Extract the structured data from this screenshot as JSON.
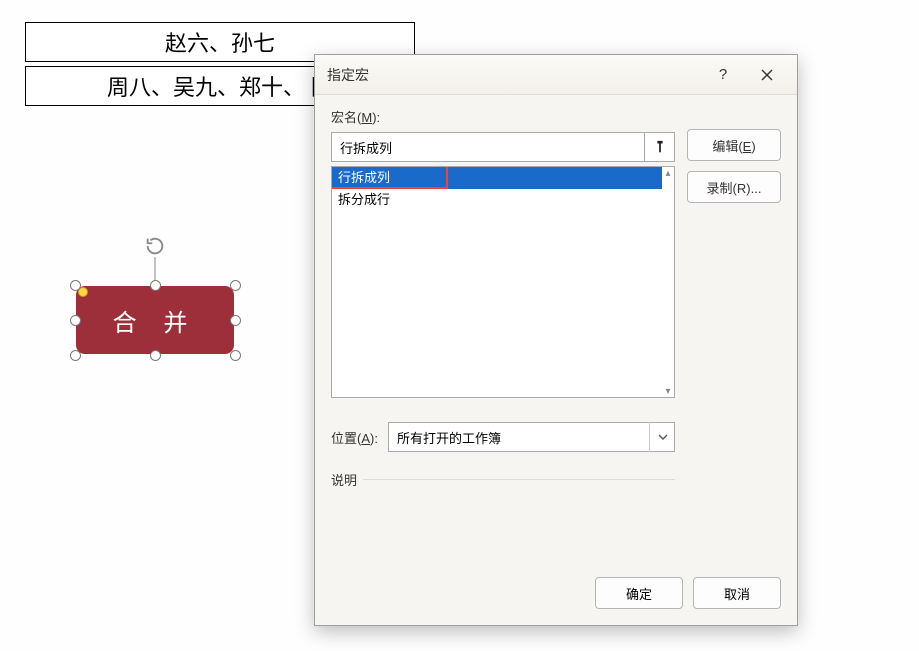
{
  "background": {
    "cell1": "赵六、孙七",
    "cell2": "周八、吴九、郑十、 陈"
  },
  "shape": {
    "label": "合 并"
  },
  "dialog": {
    "title": "指定宏",
    "help_glyph": "?",
    "macro_name_label_pre": "宏名(",
    "macro_name_label_key": "M",
    "macro_name_label_post": "):",
    "macro_name_value": "行拆成列",
    "list_items": [
      {
        "label": "行拆成列",
        "selected": true
      },
      {
        "label": "拆分成行",
        "selected": false
      }
    ],
    "buttons": {
      "edit_pre": "编辑(",
      "edit_key": "E",
      "edit_post": ")",
      "record": "录制(R)..."
    },
    "location_label_pre": "位置(",
    "location_label_key": "A",
    "location_label_post": "):",
    "location_value": "所有打开的工作簿",
    "description_label": "说明",
    "footer": {
      "ok": "确定",
      "cancel": "取消"
    }
  }
}
